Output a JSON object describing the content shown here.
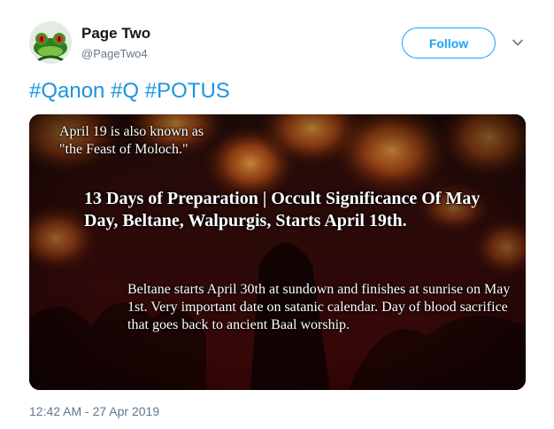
{
  "author": {
    "display_name": "Page Two",
    "handle": "@PageTwo4",
    "avatar_icon": "frog-avatar-icon"
  },
  "follow_button": {
    "label": "Follow"
  },
  "menu_icon": "chevron-down-icon",
  "tweet": {
    "hashtags": [
      "#Qanon",
      "#Q",
      "#POTUS"
    ]
  },
  "media": {
    "small_text": "April 19 is also known as \"the Feast of Moloch.\"",
    "headline": "13 Days of Preparation | Occult Significance Of May Day, Beltane, Walpurgis, Starts April 19th.",
    "body": "Beltane starts April 30th at sundown and finishes at sunrise on May 1st. Very important date on satanic calendar. Day of blood sacrifice that goes back to ancient Baal worship."
  },
  "timestamp": "12:42 AM - 27 Apr 2019",
  "colors": {
    "accent": "#1da1f2",
    "link": "#1b95e0",
    "secondary_text": "#657786"
  }
}
